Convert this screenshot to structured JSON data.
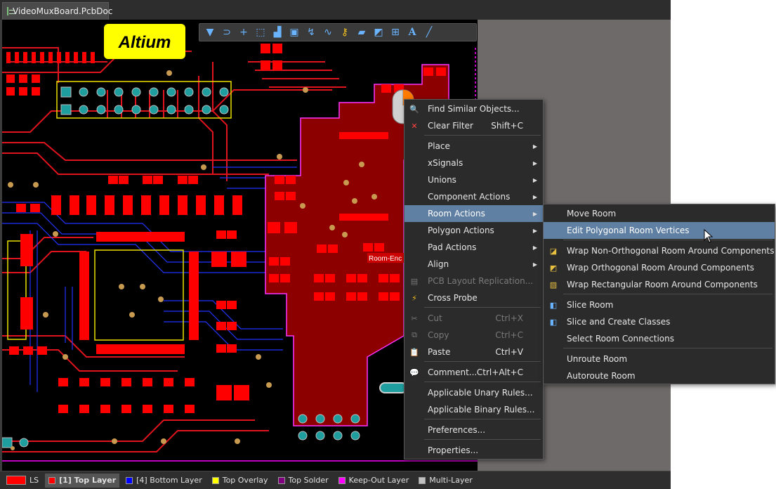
{
  "tab": {
    "title": "VideoMuxBoard.PcbDoc"
  },
  "logo": {
    "text": "Altium"
  },
  "board": {
    "room_label": "Room-Enc"
  },
  "toolbar": {
    "icons": [
      "filter-icon",
      "magnet-icon",
      "plus-icon",
      "select-rect-icon",
      "bar-chart-icon",
      "chip-icon",
      "route-icon",
      "diff-pair-icon",
      "key-icon",
      "polygon-icon",
      "line-icon",
      "dimension-icon",
      "text-icon",
      "draw-line-icon"
    ]
  },
  "context_menu": {
    "items": [
      {
        "label": "Find Similar Objects...",
        "shortcut": "",
        "submenu": false,
        "disabled": false
      },
      {
        "label": "Clear Filter",
        "shortcut": "Shift+C",
        "submenu": false,
        "disabled": false
      },
      {
        "label": "Place",
        "shortcut": "",
        "submenu": true,
        "disabled": false
      },
      {
        "label": "xSignals",
        "shortcut": "",
        "submenu": true,
        "disabled": false
      },
      {
        "label": "Unions",
        "shortcut": "",
        "submenu": true,
        "disabled": false
      },
      {
        "label": "Component Actions",
        "shortcut": "",
        "submenu": true,
        "disabled": false
      },
      {
        "label": "Room Actions",
        "shortcut": "",
        "submenu": true,
        "disabled": false
      },
      {
        "label": "Polygon Actions",
        "shortcut": "",
        "submenu": true,
        "disabled": false
      },
      {
        "label": "Pad Actions",
        "shortcut": "",
        "submenu": true,
        "disabled": false
      },
      {
        "label": "Align",
        "shortcut": "",
        "submenu": true,
        "disabled": false
      },
      {
        "label": "PCB Layout Replication...",
        "shortcut": "",
        "submenu": false,
        "disabled": true
      },
      {
        "label": "Cross Probe",
        "shortcut": "",
        "submenu": false,
        "disabled": false
      },
      {
        "label": "Cut",
        "shortcut": "Ctrl+X",
        "submenu": false,
        "disabled": true
      },
      {
        "label": "Copy",
        "shortcut": "Ctrl+C",
        "submenu": false,
        "disabled": true
      },
      {
        "label": "Paste",
        "shortcut": "Ctrl+V",
        "submenu": false,
        "disabled": false
      },
      {
        "label": "Comment...",
        "shortcut": "Ctrl+Alt+C",
        "submenu": false,
        "disabled": false
      },
      {
        "label": "Applicable Unary Rules...",
        "shortcut": "",
        "submenu": false,
        "disabled": false
      },
      {
        "label": "Applicable Binary Rules...",
        "shortcut": "",
        "submenu": false,
        "disabled": false
      },
      {
        "label": "Preferences...",
        "shortcut": "",
        "submenu": false,
        "disabled": false
      },
      {
        "label": "Properties...",
        "shortcut": "",
        "submenu": false,
        "disabled": false
      }
    ]
  },
  "room_submenu": {
    "items": [
      {
        "label": "Move Room"
      },
      {
        "label": "Edit Polygonal Room Vertices"
      },
      {
        "label": "Wrap Non-Orthogonal Room Around Components"
      },
      {
        "label": "Wrap Orthogonal Room Around Components"
      },
      {
        "label": "Wrap Rectangular Room Around Components"
      },
      {
        "label": "Slice Room"
      },
      {
        "label": "Slice and Create Classes"
      },
      {
        "label": "Select Room Connections"
      },
      {
        "label": "Unroute Room"
      },
      {
        "label": "Autoroute Room"
      }
    ]
  },
  "status_bar": {
    "layers": [
      {
        "label": "LS",
        "color": "#ff0000"
      },
      {
        "label": "[1] Top Layer",
        "color": "#ff0000"
      },
      {
        "label": "[4] Bottom Layer",
        "color": "#0000ff"
      },
      {
        "label": "Top Overlay",
        "color": "#ffff00"
      },
      {
        "label": "Top Solder",
        "color": "#800080"
      },
      {
        "label": "Keep-Out Layer",
        "color": "#ff00ff"
      },
      {
        "label": "Multi-Layer",
        "color": "#c0c0c0"
      }
    ]
  }
}
